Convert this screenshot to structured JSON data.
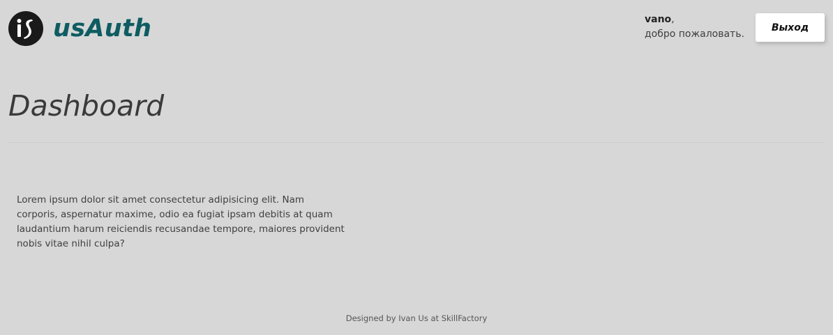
{
  "header": {
    "brand": "usAuth",
    "logo_icon": "is-monogram-icon",
    "user": {
      "name": "vano",
      "name_suffix": ",",
      "greeting": "добро пожаловать."
    },
    "logout_label": "Выход"
  },
  "main": {
    "title": "Dashboard",
    "body_text": "Lorem ipsum dolor sit amet consectetur adipisicing elit. Nam corporis, aspernatur maxime, odio ea fugiat ipsam debitis at quam laudantium harum reiciendis recusandae tempore, maiores provident nobis vitae nihil culpa?"
  },
  "footer": {
    "credit": "Designed by Ivan Us at SkillFactory"
  },
  "colors": {
    "background": "#d7d7d7",
    "brand": "#0e5c62",
    "logo_bg": "#1a1a1a"
  }
}
